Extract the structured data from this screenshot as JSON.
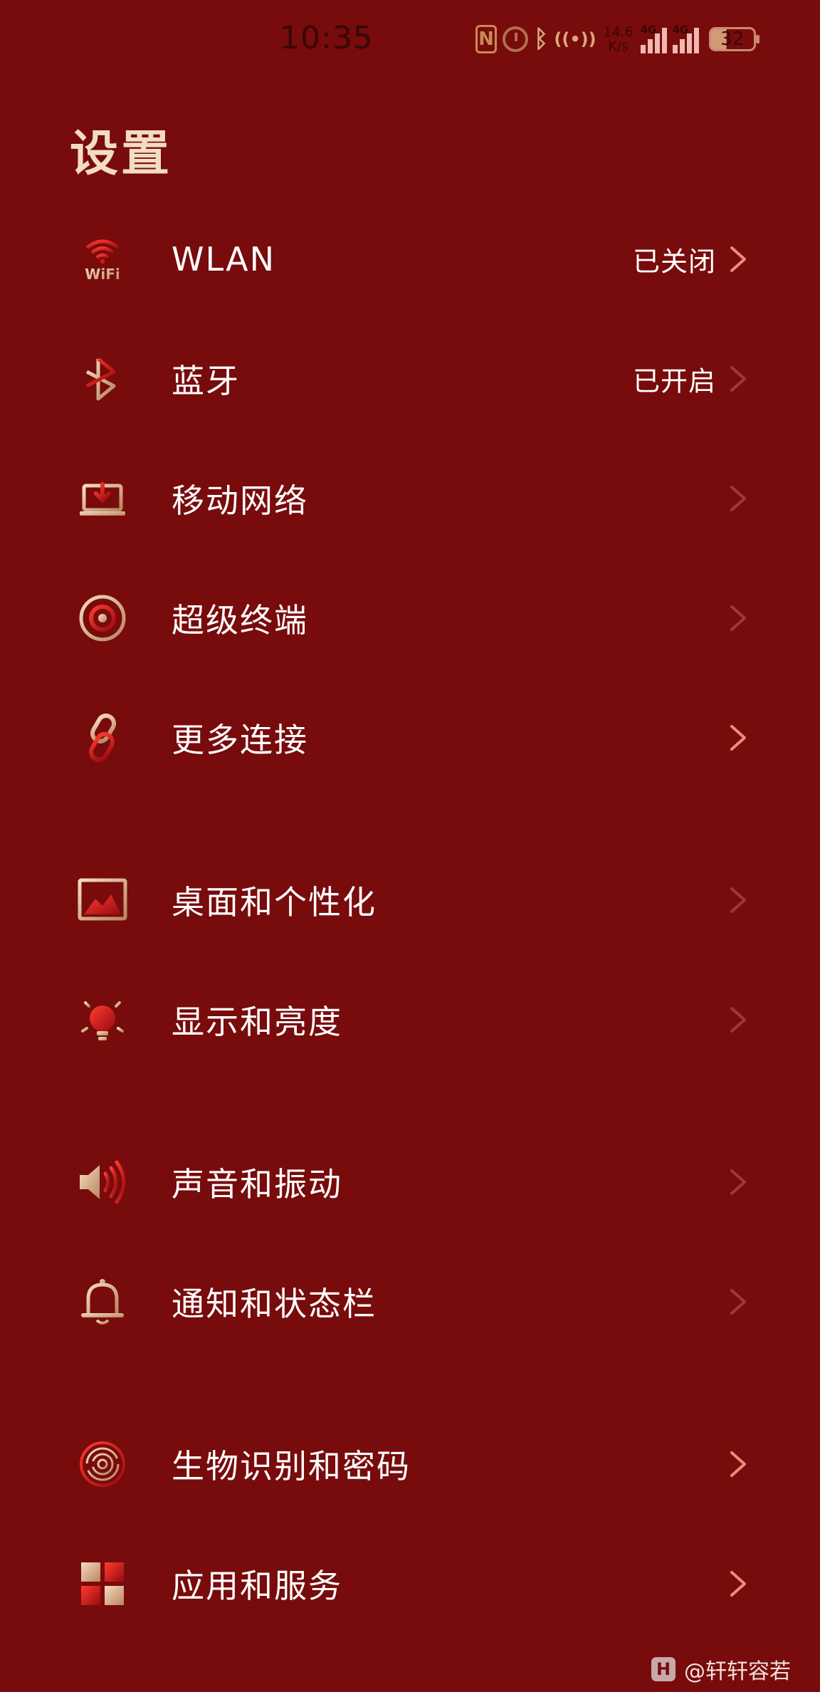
{
  "status_bar": {
    "time": "10:35",
    "nfc_letter": "N",
    "speed": "14.6\nK/s",
    "sim1_tag": "4G",
    "sim2_tag": "4G",
    "battery": "32"
  },
  "page": {
    "title": "设置"
  },
  "settings": [
    {
      "label": "WLAN",
      "status": "已关闭",
      "icon": "wifi-icon"
    },
    {
      "label": "蓝牙",
      "status": "已开启",
      "icon": "bluetooth-icon"
    },
    {
      "label": "移动网络",
      "status": "",
      "icon": "mobile-network-icon"
    },
    {
      "label": "超级终端",
      "status": "",
      "icon": "super-device-icon"
    },
    {
      "label": "更多连接",
      "status": "",
      "icon": "link-icon"
    },
    {
      "label": "桌面和个性化",
      "status": "",
      "icon": "wallpaper-icon"
    },
    {
      "label": "显示和亮度",
      "status": "",
      "icon": "brightness-icon"
    },
    {
      "label": "声音和振动",
      "status": "",
      "icon": "speaker-icon"
    },
    {
      "label": "通知和状态栏",
      "status": "",
      "icon": "bell-icon"
    },
    {
      "label": "生物识别和密码",
      "status": "",
      "icon": "fingerprint-icon"
    },
    {
      "label": "应用和服务",
      "status": "",
      "icon": "apps-icon"
    }
  ],
  "watermark": {
    "logo_letter": "H",
    "text": "@轩轩容若"
  },
  "colors": {
    "background": "#780b0c",
    "title": "#f3dcc2",
    "chevron_bright": "#f08a7a",
    "chevron_dim": "#9c3a3a",
    "icon_gold": "#d9b08a",
    "icon_red": "#d4141a"
  }
}
